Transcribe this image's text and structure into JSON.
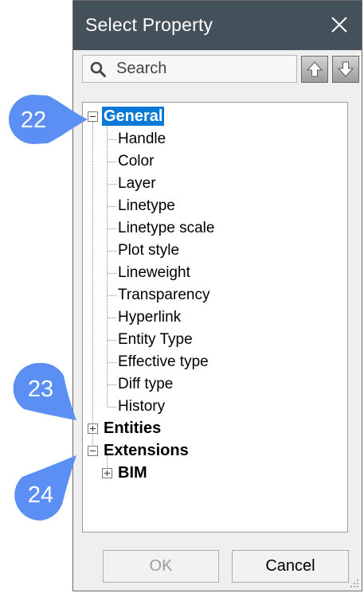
{
  "dialog": {
    "title": "Select Property",
    "search_placeholder": "Search",
    "move_up_icon": "arrow-up-icon",
    "move_down_icon": "arrow-down-icon"
  },
  "tree": {
    "general": {
      "label": "General",
      "expanded": true,
      "selected": true,
      "children": [
        "Handle",
        "Color",
        "Layer",
        "Linetype",
        "Linetype scale",
        "Plot style",
        "Lineweight",
        "Transparency",
        "Hyperlink",
        "Entity Type",
        "Effective type",
        "Diff type",
        "History"
      ]
    },
    "entities": {
      "label": "Entities",
      "expanded": false
    },
    "extensions": {
      "label": "Extensions",
      "expanded": true,
      "children": [
        {
          "label": "BIM",
          "expanded": false
        }
      ]
    }
  },
  "buttons": {
    "ok": "OK",
    "cancel": "Cancel"
  },
  "callouts": [
    {
      "number": "22",
      "target": "General"
    },
    {
      "number": "23",
      "target": "Entities"
    },
    {
      "number": "24",
      "target": "Extensions"
    }
  ],
  "colors": {
    "titlebar": "#44505a",
    "selection": "#0a78d7",
    "callout": "#5b8ff3"
  }
}
